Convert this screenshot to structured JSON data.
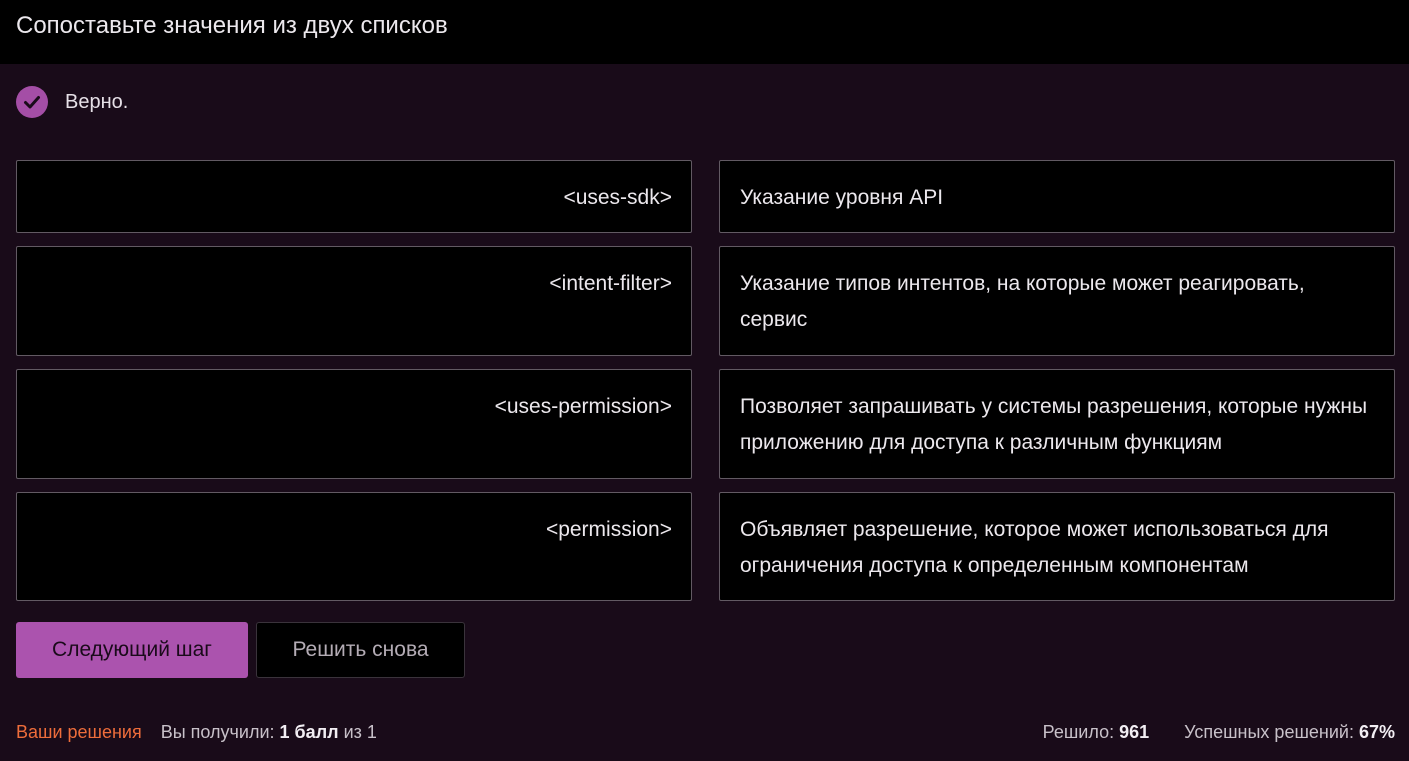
{
  "header": {
    "title": "Сопоставьте значения из двух списков"
  },
  "status": {
    "icon": "check-circle-icon",
    "text": "Верно.",
    "color": "#a44ea6"
  },
  "pairs": [
    {
      "term": "<uses-sdk>",
      "definition": "Указание уровня API"
    },
    {
      "term": "<intent-filter>",
      "definition": "Указание типов интентов, на которые может реагировать, сервис"
    },
    {
      "term": "<uses-permission>",
      "definition": "Позволяет запрашивать у системы разрешения, которые нужны приложению для доступа к различным функциям"
    },
    {
      "term": "<permission>",
      "definition": "Объявляет разрешение, которое может использоваться для ограничения доступа к определенным компонентам"
    }
  ],
  "buttons": {
    "next": "Следующий шаг",
    "retry": "Решить снова"
  },
  "footer": {
    "solutions_link": "Ваши решения",
    "received_label": "Вы получили:",
    "received_value": "1 балл",
    "received_of": "из 1",
    "solved_label": "Решило:",
    "solved_value": "961",
    "success_label": "Успешных решений:",
    "success_value": "67%"
  },
  "colors": {
    "accent": "#ab53ae",
    "link": "#ee6d3b",
    "background": "#190b19"
  }
}
